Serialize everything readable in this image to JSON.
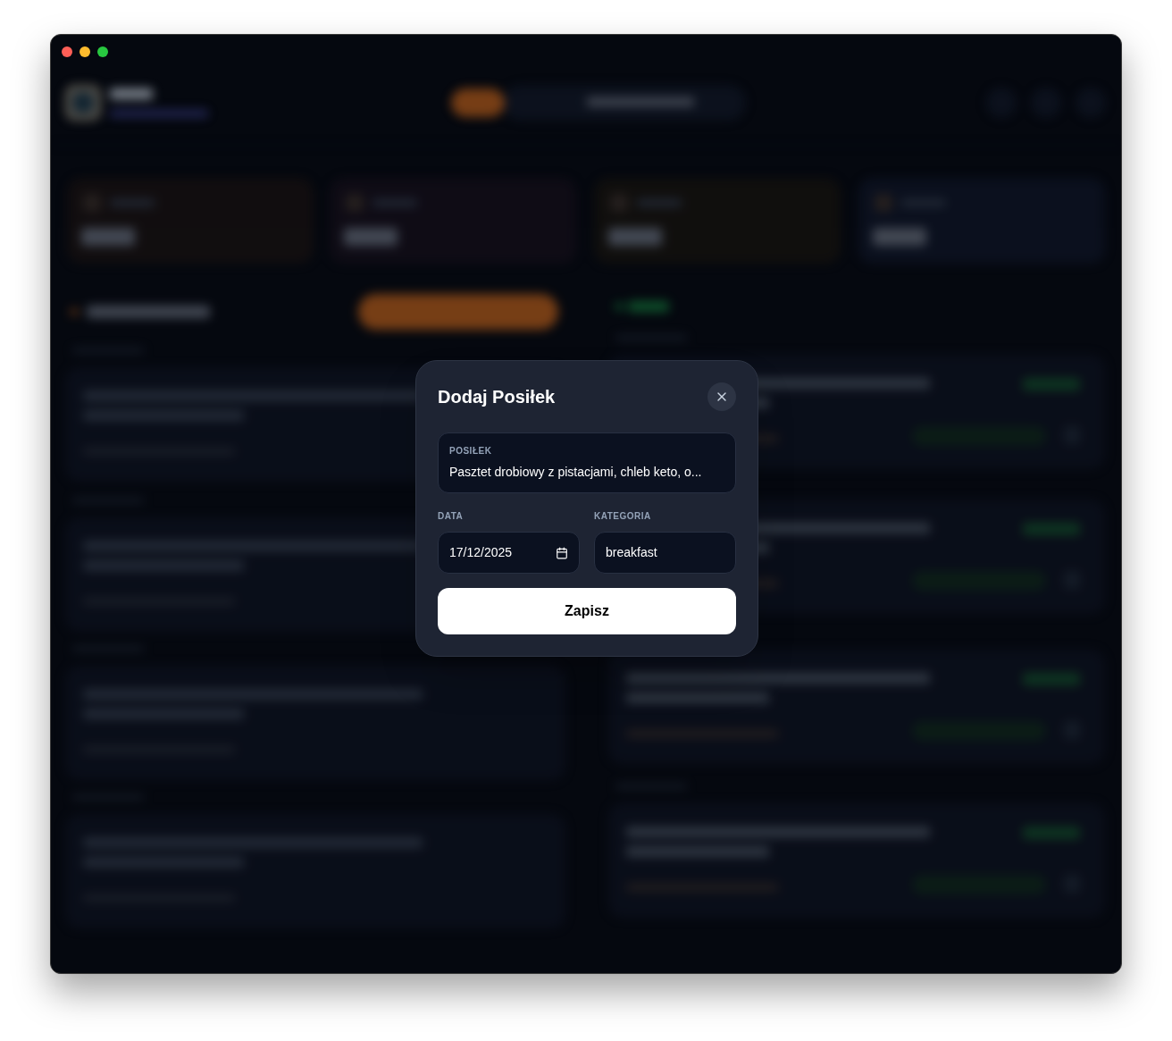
{
  "dialog": {
    "title": "Dodaj Posiłek",
    "meal_field": {
      "label": "POSIŁEK",
      "value": "Pasztet drobiowy z pistacjami, chleb keto, o..."
    },
    "date_field": {
      "label": "DATA",
      "value": "17/12/2025"
    },
    "category_field": {
      "label": "KATEGORIA",
      "value": "breakfast"
    },
    "save_button": "Zapisz"
  }
}
